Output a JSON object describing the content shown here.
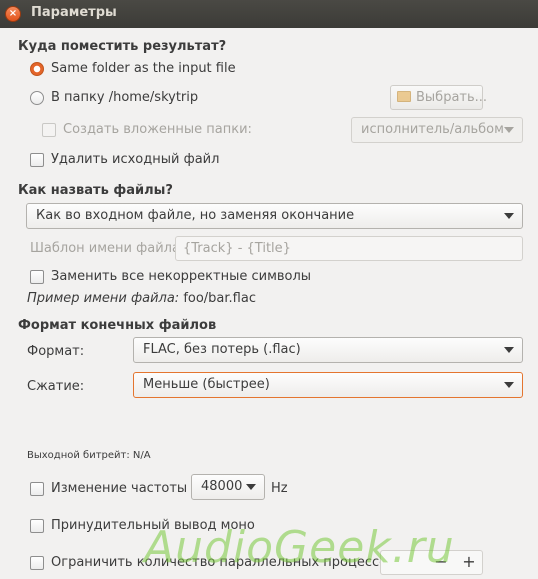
{
  "window": {
    "title": "Параметры"
  },
  "destination": {
    "header": "Куда поместить результат?",
    "same_folder_label": "Same folder as the input file",
    "to_folder_label": "В папку /home/skytrip",
    "browse_button": "Выбрать...",
    "create_subfolders_label": "Создать вложенные папки:",
    "subfolder_pattern": "исполнитель/альбом",
    "delete_original_label": "Удалить исходный файл",
    "selected": "same_folder"
  },
  "naming": {
    "header": "Как назвать файлы?",
    "mode": "Как во входном файле, но заменяя окончание",
    "template_label": "Шаблон имени файла:",
    "template_placeholder": "{Track} - {Title}",
    "replace_invalid_label": "Заменить все некорректные символы",
    "example_label": "Пример имени файла:",
    "example_value": " foo/bar.flac"
  },
  "format": {
    "header": "Формат конечных файлов",
    "format_label": "Формат:",
    "format_value": "FLAC, без потерь  (.flac)",
    "compression_label": "Сжатие:",
    "compression_value": "Меньше (быстрее)",
    "bitrate": "Выходной битрейт: N/A",
    "resample_label": "Изменение частоты",
    "sample_rate": "48000",
    "rate_unit": "Hz",
    "force_mono_label": "Принудительный вывод моно",
    "limit_jobs_label": "Ограничить количество параллельных процессов",
    "spin_minus": "−",
    "spin_plus": "+"
  },
  "watermark": "AudioGeek.ru"
}
